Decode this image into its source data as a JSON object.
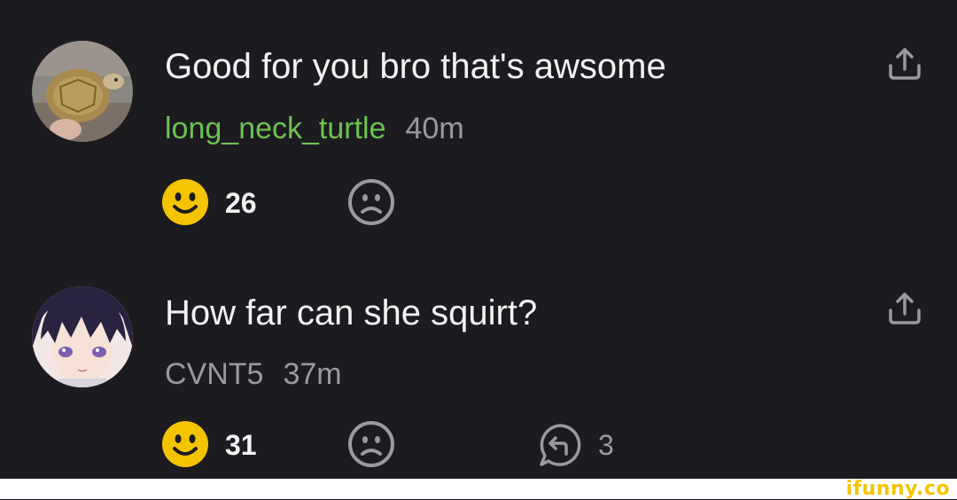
{
  "comments": [
    {
      "text": "Good for you bro that's awsome",
      "username": "long_neck_turtle",
      "username_color": "#6bc34f",
      "time": "40m",
      "smile_count": "26",
      "avatar_icon": "turtle-photo-avatar"
    },
    {
      "text": "How far can she squirt?",
      "username": "CVNT5",
      "username_color": "#9a9a9e",
      "time": "37m",
      "smile_count": "31",
      "reply_count": "3",
      "avatar_icon": "anime-girl-avatar"
    }
  ],
  "icons": {
    "share": "share-icon",
    "smile": "smile-icon",
    "unsmile": "frown-icon",
    "reply": "reply-icon"
  },
  "colors": {
    "background": "#1c1b20",
    "smile": "#f5c400",
    "muted": "#9a9a9e"
  },
  "watermark": "ifunny.co"
}
